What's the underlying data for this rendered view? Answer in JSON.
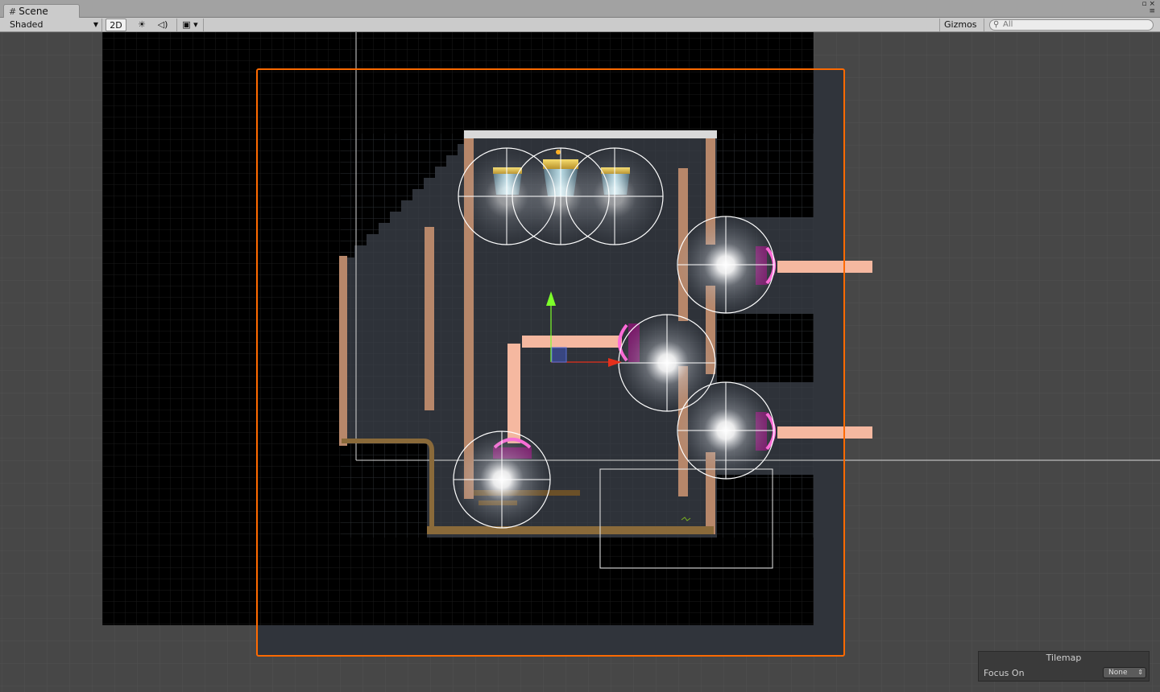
{
  "window": {
    "tab_label": "Scene",
    "tab_icon": "grid-icon"
  },
  "toolbar": {
    "shading_mode": "Shaded",
    "mode_2d_label": "2D",
    "gizmos_label": "Gizmos",
    "search_placeholder": "All",
    "icons": [
      "lighting-icon",
      "audio-icon",
      "effects-icon",
      "search-icon",
      "dropdown-arrow-icon"
    ]
  },
  "tilemap_panel": {
    "title": "Tilemap",
    "focus_label": "Focus On",
    "focus_value": "None"
  },
  "scene": {
    "objects": [
      "tilemap",
      "selection-bounds",
      "camera-bounds",
      "point-lights",
      "sentry-turrets",
      "containment-cylinders",
      "lasers",
      "move-gizmo"
    ],
    "colors": {
      "viewport_bg": "#474747",
      "void": "#000000",
      "floor": "#2e3239",
      "selection": "#ff6a00",
      "laser": "#f5b8a0",
      "wall": "#b7876a",
      "gizmo_y": "#7dff2a",
      "gizmo_x": "#e5301c"
    }
  }
}
